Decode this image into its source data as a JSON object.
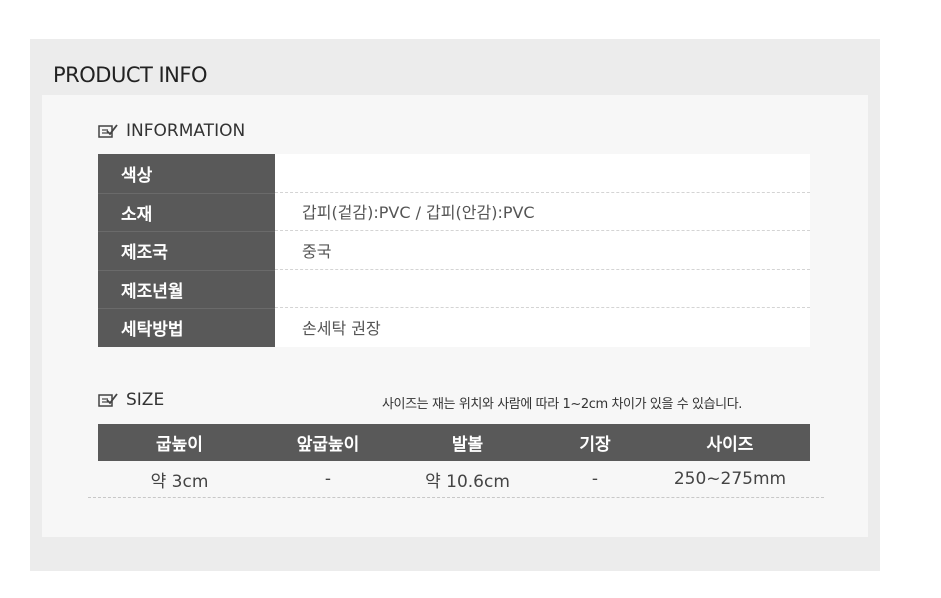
{
  "title": "PRODUCT INFO",
  "information": {
    "heading": "INFORMATION",
    "icon": "checklist-icon",
    "rows": [
      {
        "label": "색상",
        "value": ""
      },
      {
        "label": "소재",
        "value": "갑피(겉감):PVC / 갑피(안감):PVC"
      },
      {
        "label": "제조국",
        "value": "중국"
      },
      {
        "label": "제조년월",
        "value": ""
      },
      {
        "label": "세탁방법",
        "value": "손세탁 권장"
      }
    ]
  },
  "size": {
    "heading": "SIZE",
    "icon": "checklist-icon",
    "note": "사이즈는 재는 위치와 사람에 따라 1~2cm 차이가 있을 수 있습니다.",
    "headers": [
      "굽높이",
      "앞굽높이",
      "발볼",
      "기장",
      "사이즈"
    ],
    "values": [
      "약 3cm",
      "-",
      "약 10.6cm",
      "-",
      "250~275mm"
    ]
  },
  "colors": {
    "header_bg": "#595959",
    "panel_bg": "#ececec",
    "inner_bg": "#f7f7f7"
  }
}
